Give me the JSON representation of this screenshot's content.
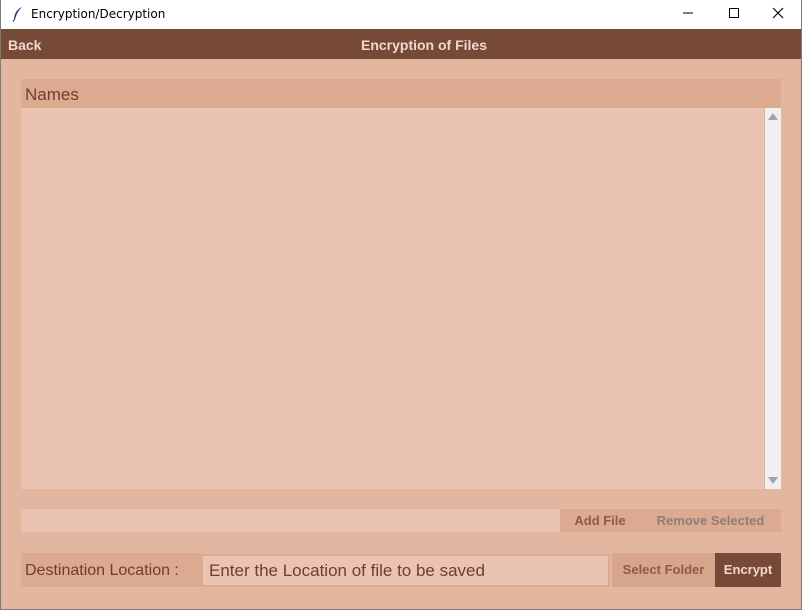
{
  "window": {
    "title": "Encryption/Decryption",
    "controls": [
      "minimize",
      "maximize",
      "close"
    ]
  },
  "header": {
    "back_label": "Back",
    "title": "Encryption of Files"
  },
  "file_list": {
    "column_header": "Names",
    "rows": []
  },
  "actions": {
    "add_file_label": "Add File",
    "remove_selected_label": "Remove Selected"
  },
  "destination": {
    "label": "Destination Location :",
    "placeholder": "Enter the Location of file to be saved",
    "value": "",
    "select_folder_label": "Select Folder",
    "encrypt_label": "Encrypt"
  },
  "colors": {
    "background": "#e3b6a0",
    "header_bar": "#774a37",
    "list_background": "#ebc3b2",
    "accent_light": "#dca991"
  },
  "icons": {
    "app": "feather-icon",
    "minimize": "minimize-icon",
    "maximize": "maximize-icon",
    "close": "close-icon",
    "scroll_up": "scroll-up-arrow-icon",
    "scroll_down": "scroll-down-arrow-icon"
  }
}
